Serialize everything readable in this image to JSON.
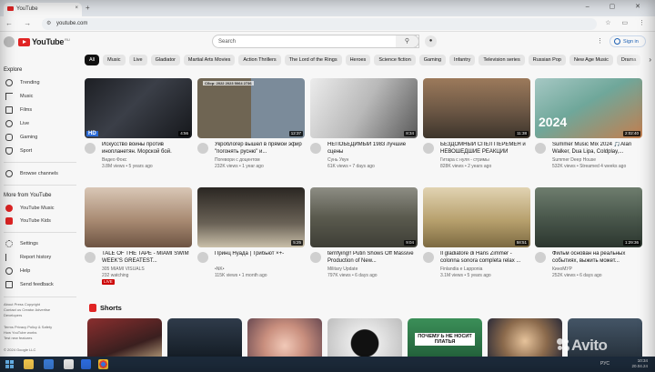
{
  "browser": {
    "tab_title": "YouTube",
    "tab_close": "×",
    "new_tab": "+",
    "url": "youtube.com",
    "window_controls": "– ▢ ✕",
    "nav_glyphs": "← → ↻",
    "toolbar_glyphs": "☆ ▭ ⋮"
  },
  "header": {
    "logo_text": "YouTube",
    "logo_region": "RU",
    "search_placeholder": "Search",
    "search_icon": "⚲",
    "mic_icon": "🎤",
    "settings_icon": "⋮",
    "sign_in_label": "Sign in"
  },
  "chips": [
    "All",
    "Music",
    "Live",
    "Gladiator",
    "Martial Arts Movies",
    "Action Thrillers",
    "The Lord of the Rings",
    "Heroes",
    "Science fiction",
    "Gaming",
    "Infantry",
    "Television series",
    "Russian Pop",
    "New Age Music",
    "Drama"
  ],
  "chip_next": "›",
  "sidebar": {
    "explore_heading": "Explore",
    "explore_items": [
      {
        "label": "Trending",
        "icon": "trending-icon"
      },
      {
        "label": "Music",
        "icon": "music-icon"
      },
      {
        "label": "Films",
        "icon": "films-icon"
      },
      {
        "label": "Live",
        "icon": "live-icon"
      },
      {
        "label": "Gaming",
        "icon": "gaming-icon"
      },
      {
        "label": "Sport",
        "icon": "sport-icon"
      }
    ],
    "browse_channels": "Browse channels",
    "more_heading": "More from YouTube",
    "more_items": [
      {
        "label": "YouTube Music",
        "icon": "youtube-music-icon"
      },
      {
        "label": "YouTube Kids",
        "icon": "youtube-kids-icon"
      }
    ],
    "settings_items": [
      {
        "label": "Settings",
        "icon": "gear-icon"
      },
      {
        "label": "Report history",
        "icon": "flag-icon"
      },
      {
        "label": "Help",
        "icon": "help-icon"
      },
      {
        "label": "Send feedback",
        "icon": "feedback-icon"
      }
    ],
    "footer_line1": "About  Press  Copyright",
    "footer_line2": "Contact us  Creator  Advertise",
    "footer_line3": "Developers",
    "footer_line4": "Terms  Privacy  Policy & Safety",
    "footer_line5": "How YouTube works",
    "footer_line6": "Test new features",
    "footer_copyright": "© 2024 Google LLC"
  },
  "videos": [
    {
      "title": "Искусство войны против инопланетян. Морской бой.",
      "channel": "Видео Фокс",
      "stats": "3.8M views • 5 years ago",
      "duration": "4:56",
      "overlay": "HD"
    },
    {
      "title": "Укроблогер вышел в прямой эфир \"погонять русню\" и...",
      "channel": "Погевори с доцентом",
      "stats": "232K views • 1 year ago",
      "duration": "12:37",
      "overlay": "Сбор: 2022 2023 5064 2736"
    },
    {
      "title": "НЕПОБЕДИМЫЙ 1983 лучшие сцены",
      "channel": "Сунь Укун",
      "stats": "61K views • 7 days ago",
      "duration": "8:34",
      "overlay": ""
    },
    {
      "title": "БЕЗДОМНЫЙ СПЕЛ ПЕРЕМЕН и НЕВОШЕДШИЕ РЕАКЦИИ",
      "channel": "Гитара с нуля - стримы",
      "stats": "828K views • 2 years ago",
      "duration": "11:38",
      "overlay": ""
    },
    {
      "title": "Summer Music Mix 2024 🎵Alan Walker, Dua Lipa, Coldplay,...",
      "channel": "Summer Deep House",
      "stats": "532K views • Streamed 4 weeks ago",
      "duration": "2:02:40",
      "overlay": "2024"
    },
    {
      "title": "TALE OF THE TAPE - MIAMI SWIM WEEK'S GREATEST...",
      "channel": "305 MIAMI VISUALS",
      "stats": "232 watching",
      "duration": "",
      "overlay": "",
      "badge": "LIVE"
    },
    {
      "title": "Принц Нуада | Трибьют ×+-",
      "channel": "•NK•",
      "stats": "115K views • 1 month ago",
      "duration": "5:25",
      "overlay": ""
    },
    {
      "title": "terrifying!! Putin Shows Off Massive Production of New...",
      "channel": "Military Update",
      "stats": "797K views • 6 days ago",
      "duration": "9:04",
      "overlay": ""
    },
    {
      "title": "Il gladiatore di Hans Zimmer - colonna sonora completa relax ...",
      "channel": "Finlandia e Lapponia",
      "stats": "3.1M views • 5 years ago",
      "duration": "58:51",
      "overlay": ""
    },
    {
      "title": "Фильм основан на реальных событиях, выжить может...",
      "channel": "КиноМУР",
      "stats": "252K views • 6 days ago",
      "duration": "1:29:36",
      "overlay": ""
    }
  ],
  "shorts": {
    "heading": "Shorts",
    "overlay_text": "ПОЧЕМУ Ь НЕ НОСИТ ПЛАТЬЯ"
  },
  "taskbar": {
    "language": "РУС",
    "time": "10:34",
    "date": "20.04.24"
  },
  "watermark": "Avito",
  "colors": {
    "brand_red": "#e02424",
    "chip_bg": "#e5e5e5",
    "active_chip": "#111111",
    "taskbar": "#1c2a3a"
  }
}
